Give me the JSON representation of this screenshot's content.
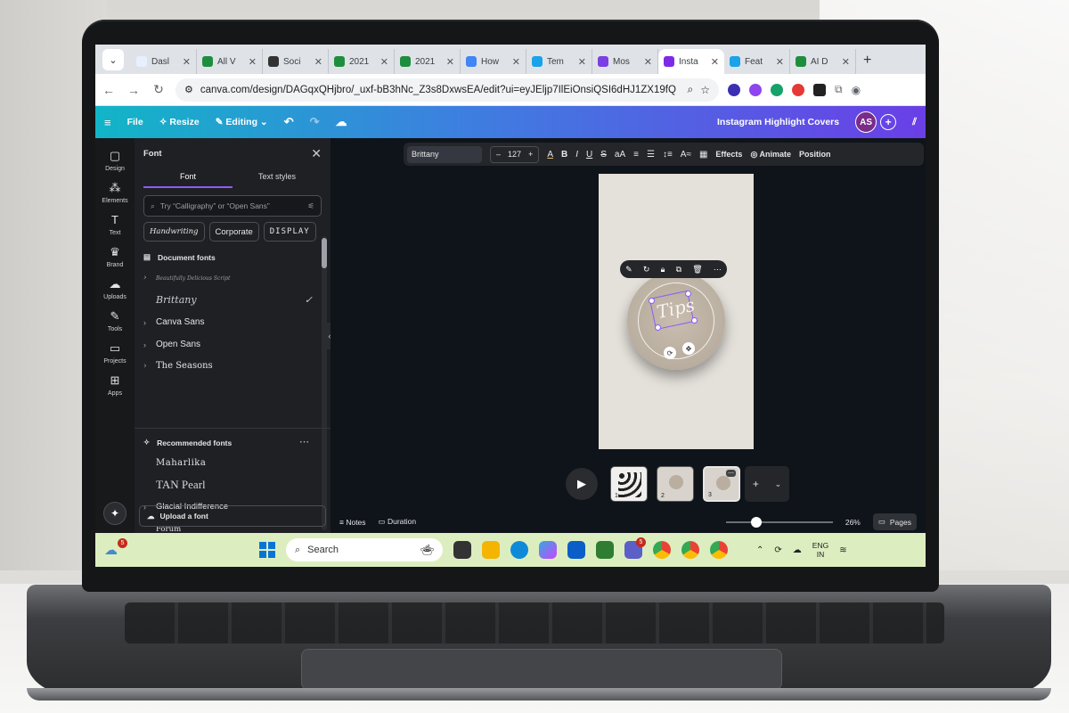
{
  "browser": {
    "tabs": [
      {
        "label": "Dasl",
        "color": "#e8f0fe"
      },
      {
        "label": "All V",
        "color": "#1e8e3e"
      },
      {
        "label": "Soci",
        "color": "#333333"
      },
      {
        "label": "2021",
        "color": "#1e8e3e"
      },
      {
        "label": "2021",
        "color": "#1e8e3e"
      },
      {
        "label": "How",
        "color": "#4285f4"
      },
      {
        "label": "Tem",
        "color": "#1aa3e8"
      },
      {
        "label": "Mos",
        "color": "#7b3fe4"
      },
      {
        "label": "Insta",
        "color": "#7d2ae8"
      },
      {
        "label": "Feat",
        "color": "#1aa3e8"
      },
      {
        "label": "AI D",
        "color": "#1e8e3e"
      }
    ],
    "url": "canva.com/design/DAGqxQHjbro/_uxf-bB3hNc_Z3s8DxwsEA/edit?ui=eyJEljp7IlEiOnsiQSI6dHJ1ZX19fQ"
  },
  "canva_header": {
    "file": "File",
    "resize": "Resize",
    "editing": "Editing",
    "design_title": "Instagram Highlight Covers",
    "avatar_initials": "AS"
  },
  "rail": [
    {
      "label": "Design",
      "icon": "design-icon",
      "glyph": "▢"
    },
    {
      "label": "Elements",
      "icon": "elements-icon",
      "glyph": "⁂"
    },
    {
      "label": "Text",
      "icon": "text-icon",
      "glyph": "T"
    },
    {
      "label": "Brand",
      "icon": "brand-icon",
      "glyph": "♛"
    },
    {
      "label": "Uploads",
      "icon": "uploads-icon",
      "glyph": "☁"
    },
    {
      "label": "Tools",
      "icon": "tools-icon",
      "glyph": "✎"
    },
    {
      "label": "Projects",
      "icon": "projects-icon",
      "glyph": "▭"
    },
    {
      "label": "Apps",
      "icon": "apps-icon",
      "glyph": "⊞"
    }
  ],
  "font_panel": {
    "title": "Font",
    "tab_font": "Font",
    "tab_text_styles": "Text styles",
    "search_placeholder": "Try “Calligraphy” or “Open Sans”",
    "chips": [
      "Handwriting",
      "Corporate",
      "DISPLAY"
    ],
    "document_fonts_heading": "Document fonts",
    "document_fonts": [
      "Beautifully Delicious Script",
      "Brittany",
      "Canva Sans",
      "Open Sans",
      "The Seasons"
    ],
    "recommended_heading": "Recommended fonts",
    "recommended_fonts": [
      "Maharlika",
      "TAN Pearl",
      "Glacial Indifference",
      "Forum"
    ],
    "upload_label": "Upload a font"
  },
  "text_toolbar": {
    "font_name": "Brittany",
    "font_size": "127",
    "effects": "Effects",
    "animate": "Animate",
    "position": "Position"
  },
  "canvas": {
    "element_text": "Tips"
  },
  "pages": [
    {
      "num": "1"
    },
    {
      "num": "2"
    },
    {
      "num": "3"
    }
  ],
  "footer": {
    "notes": "Notes",
    "duration": "Duration",
    "zoom": "26%",
    "pages": "Pages"
  },
  "taskbar": {
    "weather_badge": "5",
    "search_placeholder": "Search",
    "teams_badge": "5",
    "lang_top": "ENG",
    "lang_bottom": "IN"
  }
}
